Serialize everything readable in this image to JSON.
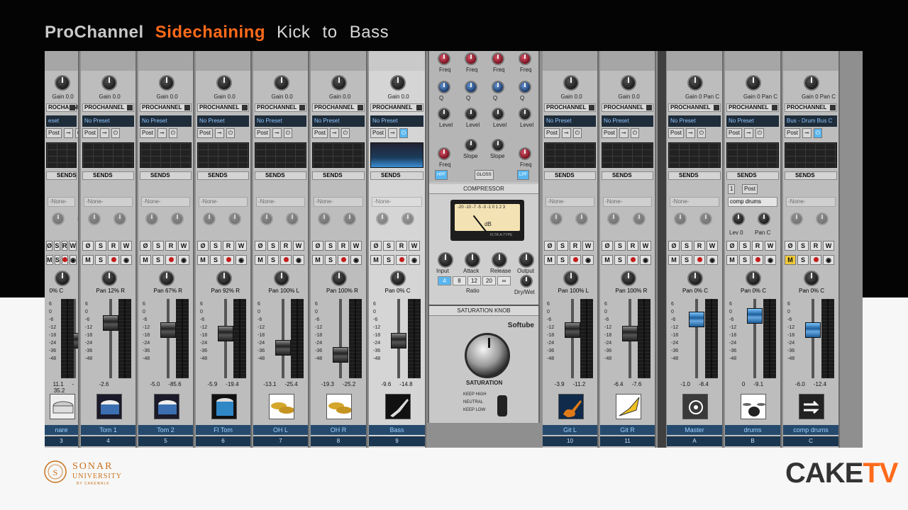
{
  "title": {
    "part1": "ProChannel",
    "part2": "Sidechaining",
    "part3": "Kick to Bass"
  },
  "colors": {
    "accent": "#ff6a1a",
    "selected_blue": "#59b7f0",
    "background_top": "#040404"
  },
  "strips": [
    {
      "name": "nare",
      "number": "3",
      "gain": "Gain 0.0",
      "prochannel": "ROCHANNEL",
      "preset": "eset",
      "pan": "0% C",
      "levels": [
        "11.1",
        "-35.2"
      ],
      "icon": "snare-drum-icon"
    },
    {
      "name": "Tom 1",
      "number": "4",
      "gain": "Gain 0.0",
      "prochannel": "PROCHANNEL",
      "preset": "No Preset",
      "pan": "Pan 12% R",
      "levels": [
        "-2.6",
        ""
      ],
      "icon": "tom-drum-icon"
    },
    {
      "name": "Tom 2",
      "number": "5",
      "gain": "Gain 0.0",
      "prochannel": "PROCHANNEL",
      "preset": "No Preset",
      "pan": "Pan 67% R",
      "levels": [
        "-5.0",
        "-85.6"
      ],
      "icon": "tom-drum-icon"
    },
    {
      "name": "Fl Tom",
      "number": "6",
      "gain": "Gain 0.0",
      "prochannel": "PROCHANNEL",
      "preset": "No Preset",
      "pan": "Pan 92% R",
      "levels": [
        "-5.9",
        "-19.4"
      ],
      "icon": "floor-tom-icon"
    },
    {
      "name": "OH L",
      "number": "7",
      "gain": "Gain 0.0",
      "prochannel": "PROCHANNEL",
      "preset": "No Preset",
      "pan": "Pan 100% L",
      "levels": [
        "-13.1",
        "-25.4"
      ],
      "icon": "cymbals-icon"
    },
    {
      "name": "OH R",
      "number": "8",
      "gain": "Gain 0.0",
      "prochannel": "PROCHANNEL",
      "preset": "No Preset",
      "pan": "Pan 100% R",
      "levels": [
        "-19.3",
        "-25.2"
      ],
      "icon": "cymbals-icon"
    },
    {
      "name": "Bass",
      "number": "9",
      "gain": "Gain 0.0",
      "prochannel": "PROCHANNEL",
      "preset": "No Preset",
      "pan": "Pan 0% C",
      "levels": [
        "-9.6",
        "-14.8"
      ],
      "icon": "bass-guitar-icon"
    },
    {
      "name": "Git L",
      "number": "10",
      "gain": "Gain 0.0",
      "prochannel": "PROCHANNEL",
      "preset": "No Preset",
      "pan": "Pan 100% L",
      "levels": [
        "-3.9",
        "-11.2"
      ],
      "icon": "electric-guitar-icon"
    },
    {
      "name": "Git R",
      "number": "11",
      "gain": "Gain 0.0",
      "prochannel": "PROCHANNEL",
      "preset": "No Preset",
      "pan": "Pan 100% R",
      "levels": [
        "-6.4",
        "-7.6"
      ],
      "icon": "flying-v-guitar-icon"
    },
    {
      "name": "Master",
      "number": "A",
      "gain": "Gain 0 Pan C",
      "prochannel": "PROCHANNEL",
      "preset": "No Preset",
      "pan": "Pan 0% C",
      "levels": [
        "-1.0",
        "-8.4"
      ],
      "icon": "master-output-icon"
    },
    {
      "name": "drums",
      "number": "B",
      "gain": "Gain 0 Pan C",
      "prochannel": "PROCHANNEL",
      "preset": "No Preset",
      "pan": "Pan 0% C",
      "levels": [
        "0",
        "-9.1"
      ],
      "icon": "drum-kit-icon"
    },
    {
      "name": "comp drums",
      "number": "C",
      "gain": "Gain 0 Pan C",
      "prochannel": "PROCHANNEL",
      "preset": "Bus - Drum Bus C",
      "pan": "Pan 0% C",
      "levels": [
        "-6.0",
        "-12.4"
      ],
      "icon": "arrow-right-icon"
    }
  ],
  "common": {
    "post": "Post",
    "sends": "SENDS",
    "none": "-None-",
    "lev": "Lev",
    "pan_short": "Pan",
    "m": "M",
    "s": "S",
    "r": "R",
    "w": "W",
    "phase": "Ø",
    "scale": [
      "6",
      "0",
      "-6",
      "-12",
      "-18",
      "-24",
      "-36",
      "-48"
    ]
  },
  "drums_send": {
    "number": "1",
    "post": "Post",
    "dest": "comp drums",
    "lev": "Lev 0",
    "pan": "Pan C"
  },
  "prochannel_panel": {
    "eq_labels": {
      "freq": "Freq",
      "q": "Q",
      "level": "Level",
      "slope": "Slope",
      "hpf": "HPF",
      "gloss": "GLOSS",
      "lpf": "LPF"
    },
    "compressor": {
      "title": "COMPRESSOR",
      "vu_scale": "-20 -10 -7 -5 -3 -1 0 1 2 3",
      "vu_unit": "dB",
      "vu_mode": "FLTR A-TYPE",
      "knobs": [
        "Input",
        "Attack",
        "Release",
        "Output"
      ],
      "ratio_label": "Ratio",
      "ratios": [
        "4",
        "8",
        "12",
        "20",
        "∞"
      ],
      "active_ratio": "4",
      "drywet": "Dry/Wet"
    },
    "saturation": {
      "title": "SATURATION KNOB",
      "brand": "Softube",
      "knob_label": "SATURATION",
      "modes": [
        "KEEP HIGH",
        "NEUTRAL",
        "KEEP LOW"
      ]
    }
  },
  "footer": {
    "left_logo_line1": "SONAR",
    "left_logo_line2": "UNIVERSITY",
    "left_logo_line3": "BY CAKEWALK",
    "right_logo_part1": "CAKE",
    "right_logo_part2": "TV"
  }
}
